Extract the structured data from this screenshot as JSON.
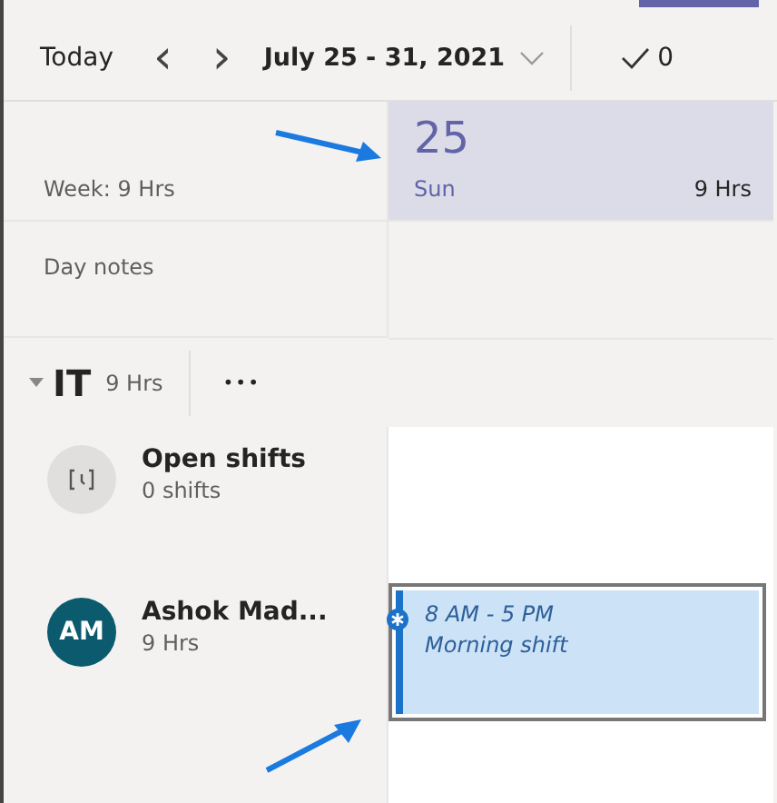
{
  "toolbar": {
    "today": "Today",
    "prev": "‹",
    "next": "›",
    "range": "July 25 - 31, 2021",
    "approved_count": "0"
  },
  "header": {
    "week": "Week: 9 Hrs",
    "day_number": "25",
    "weekday": "Sun",
    "day_hours": "9 Hrs",
    "selected": true
  },
  "day_notes": {
    "label": "Day notes"
  },
  "group": {
    "name": "IT",
    "hours": "9 Hrs",
    "expanded": true,
    "more": "•••"
  },
  "rows": [
    {
      "kind": "open",
      "title": "Open shifts",
      "subtitle": "0 shifts"
    },
    {
      "kind": "member",
      "initials": "AM",
      "title": "Ashok Mad...",
      "subtitle": "9 Hrs",
      "color": "#0b5a6e",
      "shift": {
        "time": "8 AM - 5 PM",
        "name": "Morning shift",
        "selected": true
      }
    }
  ]
}
